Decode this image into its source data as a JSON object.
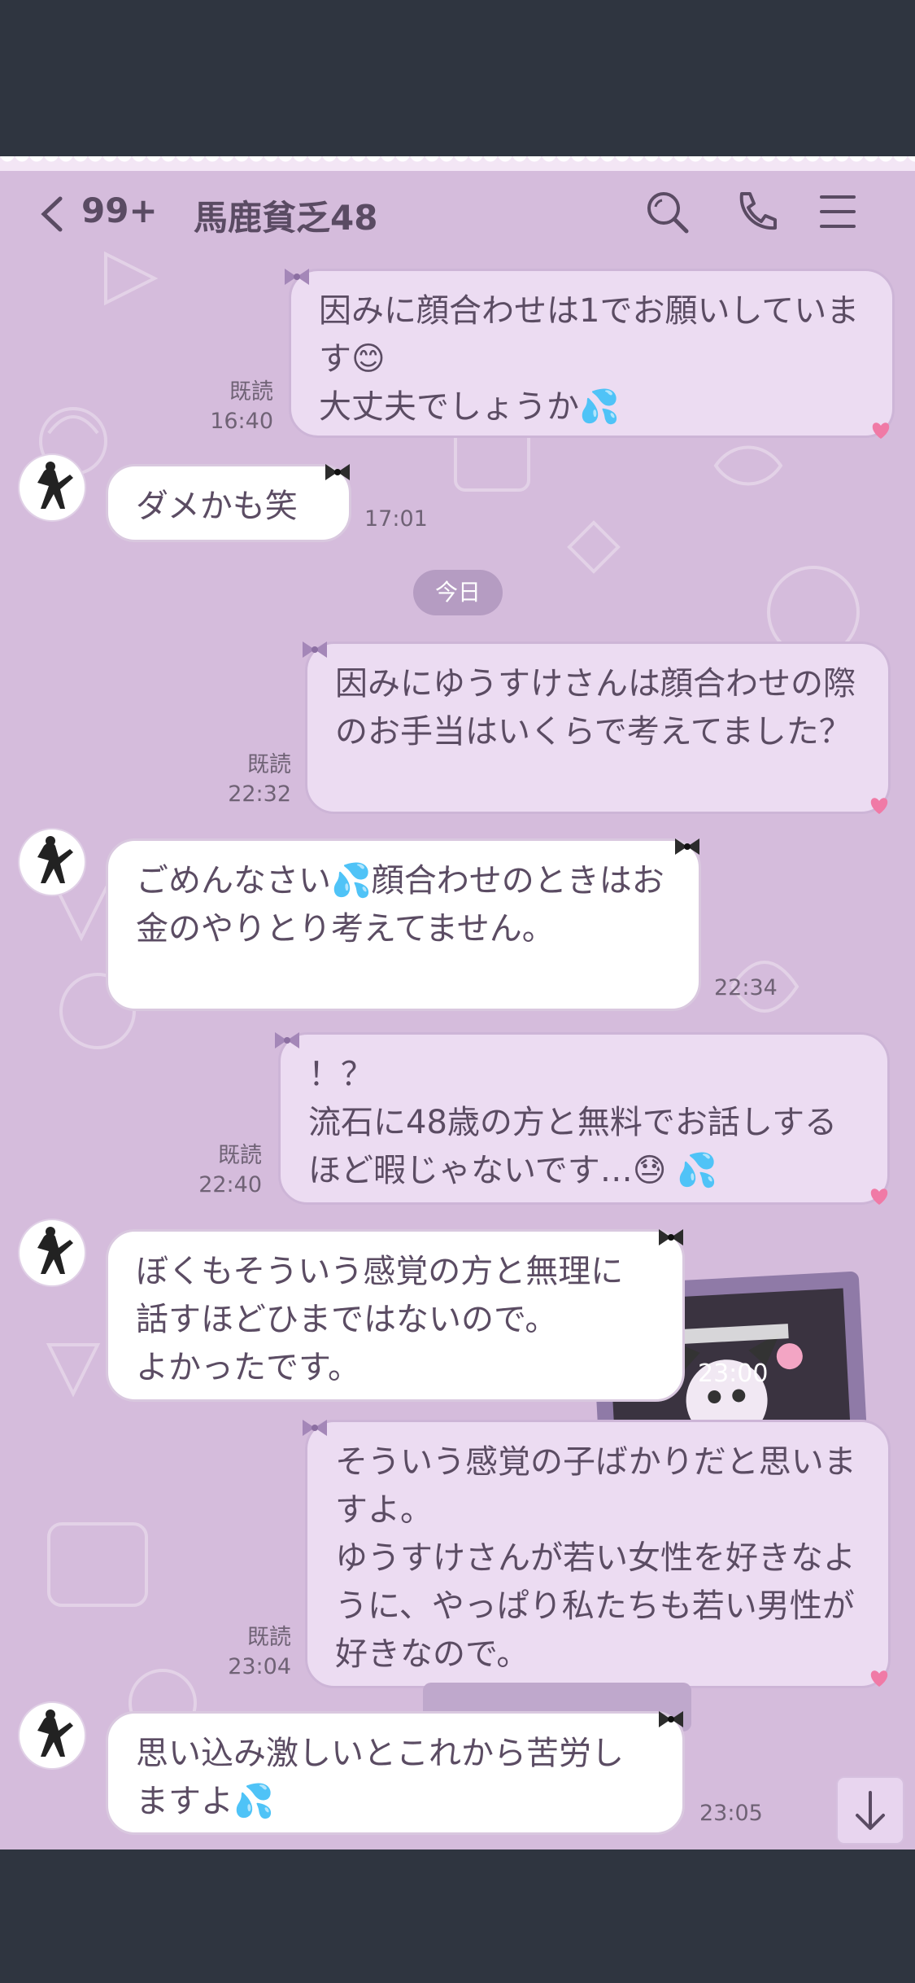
{
  "header": {
    "unread_count": "99+",
    "chat_name": "馬鹿貧乏48",
    "icons": [
      "back-chevron-icon",
      "search-icon",
      "phone-icon",
      "menu-icon"
    ]
  },
  "date_separator": "今日",
  "messages": [
    {
      "side": "out",
      "text": "因みに顔合わせは1でお願いしています😊\n大丈夫でしょうか💦",
      "read": "既読",
      "time": "16:40"
    },
    {
      "side": "in",
      "text": "ダメかも笑",
      "time": "17:01"
    },
    {
      "side": "out",
      "text": "因みにゆうすけさんは顔合わせの際のお手当はいくらで考えてました？",
      "read": "既読",
      "time": "22:32"
    },
    {
      "side": "in",
      "text": "ごめんなさい💦顔合わせのときはお金のやりとり考えてません。",
      "time": "22:34"
    },
    {
      "side": "out",
      "text": "！？\n流石に48歳の方と無料でお話しするほど暇じゃないです…😓 💦",
      "read": "既読",
      "time": "22:40"
    },
    {
      "side": "in",
      "text": "ぼくもそういう感覚の方と無理に話すほどひまではないので。\nよかったです。",
      "time": ""
    },
    {
      "side": "sticker",
      "time": "23:00"
    },
    {
      "side": "out",
      "text": "そういう感覚の子ばかりだと思いますよ。\nゆうすけさんが若い女性を好きなように、やっぱり私たちも若い男性が好きなので。",
      "read": "既読",
      "time": "23:04"
    },
    {
      "side": "in",
      "text": "思い込み激しいとこれから苦労しますよ💦",
      "time": "23:05"
    }
  ],
  "colors": {
    "chat_background": "#d5bcdc",
    "outgoing_bubble": "#ecdcf2",
    "incoming_bubble": "#ffffff",
    "text": "#5b4c63",
    "frame": "#2f3540"
  },
  "scroll_button_icon": "arrow-down-icon"
}
